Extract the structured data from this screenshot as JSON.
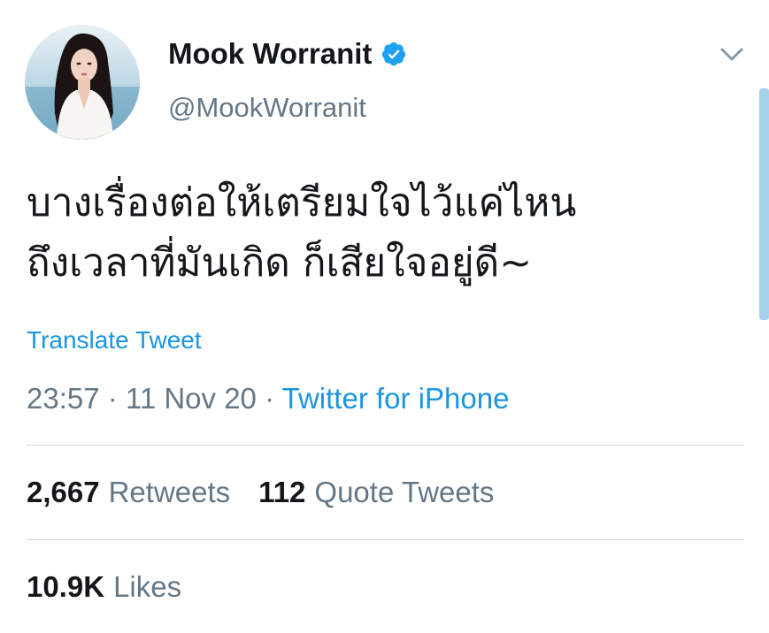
{
  "user": {
    "display_name": "Mook Worranit",
    "handle": "@MookWorranit",
    "verified": true
  },
  "tweet": {
    "lines": [
      "บางเรื่องต่อให้เตรียมใจไว้แค่ไหน",
      "ถึงเวลาที่มันเกิด ก็เสียใจอยู่ดี~"
    ],
    "translate_label": "Translate Tweet",
    "time": "23:57",
    "separator": " · ",
    "date": "11 Nov 20",
    "source": "Twitter for iPhone"
  },
  "stats": {
    "retweets_count": "2,667",
    "retweets_label": "Retweets",
    "quote_count": "112",
    "quote_label": "Quote Tweets",
    "likes_count": "10.9K",
    "likes_label": "Likes"
  },
  "colors": {
    "link": "#1b95e0",
    "secondary_text": "#657786",
    "primary_text": "#14171a",
    "divider": "#ccd6dd",
    "verified_badge": "#1da1f2"
  },
  "icons": [
    "verified-badge-icon",
    "chevron-down-icon"
  ]
}
